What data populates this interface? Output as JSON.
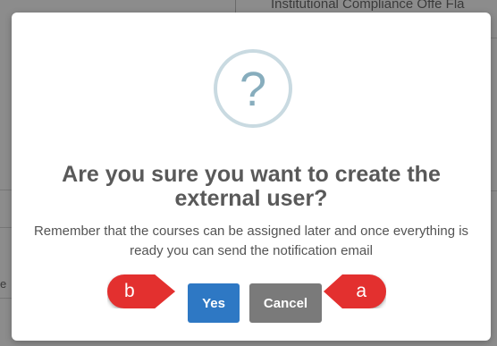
{
  "background": {
    "top_text": "Institutional Compliance Offe Fla",
    "left_fragment": "e"
  },
  "dialog": {
    "icon": "question-mark-icon",
    "icon_glyph": "?",
    "title": "Are you sure you want to create the external user?",
    "message": "Remember that the courses can be assigned later and once everything is ready you can send the notification email",
    "confirm_label": "Yes",
    "cancel_label": "Cancel"
  },
  "annotations": {
    "b_label": "b",
    "a_label": "a",
    "color": "#e3302f"
  },
  "colors": {
    "confirm_button": "#2e78c4",
    "cancel_button": "#7a7a7a",
    "icon_ring": "#c9dae1",
    "icon_glyph": "#87adbd"
  }
}
